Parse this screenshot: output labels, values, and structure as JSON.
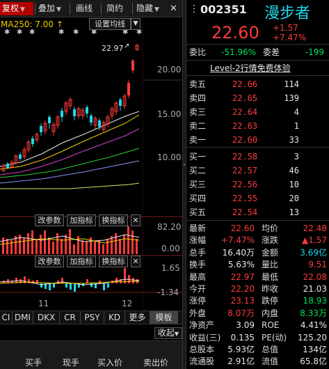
{
  "toolbar": {
    "items": [
      {
        "label": "复权",
        "arrow": "▼",
        "active": true
      },
      {
        "label": "叠加",
        "arrow": "▼",
        "active": false
      },
      {
        "label": "画线",
        "arrow": "",
        "active": false
      },
      {
        "label": "简约",
        "arrow": "",
        "active": false
      },
      {
        "label": "隐藏",
        "arrow": "▼",
        "active": false
      }
    ],
    "close_glyph": "✕",
    "menu_glyph": "⋮"
  },
  "chart": {
    "ma_label": "MA250: 7.00 ↑",
    "set_ma_button": "设置均线",
    "high_label": "22.97",
    "y_ticks": [
      "20.00",
      "15.00",
      "10.00"
    ],
    "sub1": {
      "param_btn": "改参数",
      "add_btn": "加指标",
      "switch_btn": "换指标",
      "close": "✕",
      "y_ticks": [
        "82.20",
        "0.00"
      ]
    },
    "sub2": {
      "param_btn": "改参数",
      "add_btn": "加指标",
      "switch_btn": "换指标",
      "close": "✕",
      "y_ticks": [
        "1.65",
        "-1.34"
      ]
    },
    "x_ticks": [
      "11",
      "12"
    ],
    "collapse_btn": "收起"
  },
  "indicator_tabs": [
    "CI",
    "DMI",
    "DKX",
    "CR",
    "PSY",
    "KD",
    "更多",
    "模板"
  ],
  "tradebar": [
    "买手",
    "现手",
    "买入价",
    "卖出价"
  ],
  "stock": {
    "code": "002351",
    "name": "漫步者",
    "price": "22.60",
    "change": "+1.57",
    "change_pct": "+7.47%",
    "weibi_label": "委比",
    "weibi": "-51.96%",
    "weicha_label": "委差",
    "weicha": "-199",
    "level2": "Level-2行情免费体验"
  },
  "asks": [
    {
      "label": "卖五",
      "price": "22.66",
      "vol": "114"
    },
    {
      "label": "卖四",
      "price": "22.65",
      "vol": "139"
    },
    {
      "label": "卖三",
      "price": "22.64",
      "vol": "4"
    },
    {
      "label": "卖二",
      "price": "22.63",
      "vol": "1"
    },
    {
      "label": "卖一",
      "price": "22.60",
      "vol": "33"
    }
  ],
  "bids": [
    {
      "label": "买一",
      "price": "22.58",
      "vol": "3"
    },
    {
      "label": "买二",
      "price": "22.57",
      "vol": "46"
    },
    {
      "label": "买三",
      "price": "22.56",
      "vol": "10"
    },
    {
      "label": "买四",
      "price": "22.55",
      "vol": "20"
    },
    {
      "label": "买五",
      "price": "22.54",
      "vol": "13"
    }
  ],
  "stats": [
    {
      "l1": "最新",
      "v1": "22.60",
      "c1": "red",
      "l2": "均价",
      "v2": "22.48",
      "c2": "red"
    },
    {
      "l1": "涨幅",
      "v1": "+7.47%",
      "c1": "red",
      "l2": "涨跌",
      "v2": "▲1.57",
      "c2": "red"
    },
    {
      "l1": "总手",
      "v1": "16.40万",
      "c1": "white",
      "l2": "金额",
      "v2": "3.69亿",
      "c2": "cyan"
    },
    {
      "l1": "换手",
      "v1": "5.63%",
      "c1": "white",
      "l2": "量比",
      "v2": "9.51",
      "c2": "red"
    },
    {
      "l1": "最高",
      "v1": "22.97",
      "c1": "red",
      "l2": "最低",
      "v2": "22.08",
      "c2": "red"
    },
    {
      "l1": "今开",
      "v1": "22.20",
      "c1": "red",
      "l2": "昨收",
      "v2": "21.03",
      "c2": "white"
    },
    {
      "l1": "涨停",
      "v1": "23.13",
      "c1": "red",
      "l2": "跌停",
      "v2": "18.93",
      "c2": "green"
    },
    {
      "l1": "外盘",
      "v1": "8.07万",
      "c1": "red",
      "l2": "内盘",
      "v2": "8.33万",
      "c2": "green"
    },
    {
      "l1": "净资产",
      "v1": "3.09",
      "c1": "white",
      "l2": "ROE",
      "v2": "4.41%",
      "c2": "white"
    },
    {
      "l1": "收益(三)",
      "v1": "0.135",
      "c1": "white",
      "l2": "PE(动)",
      "v2": "125.20",
      "c2": "white"
    },
    {
      "l1": "总股本",
      "v1": "5.93亿",
      "c1": "white",
      "l2": "总值",
      "v2": "134亿",
      "c2": "white"
    },
    {
      "l1": "流通股",
      "v1": "2.91亿",
      "c1": "white",
      "l2": "流值",
      "v2": "65.8亿",
      "c2": "white"
    }
  ]
}
